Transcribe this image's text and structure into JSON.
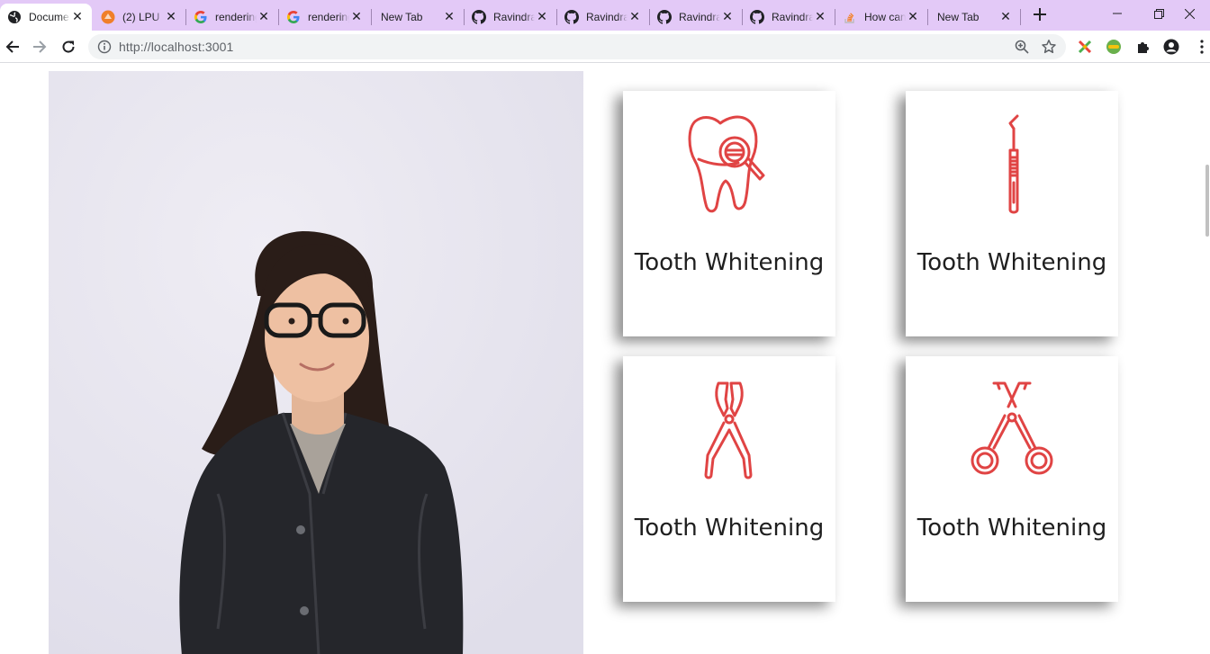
{
  "browser": {
    "tabs": [
      {
        "title": "Document",
        "icon": "globe-icon",
        "active": true
      },
      {
        "title": "(2) LPU",
        "icon": "lpu-icon"
      },
      {
        "title": "rendering",
        "icon": "google-icon"
      },
      {
        "title": "rendering",
        "icon": "google-icon"
      },
      {
        "title": "New Tab",
        "icon": ""
      },
      {
        "title": "Ravindra",
        "icon": "github-icon"
      },
      {
        "title": "Ravindra",
        "icon": "github-icon"
      },
      {
        "title": "Ravindra",
        "icon": "github-icon"
      },
      {
        "title": "Ravindra",
        "icon": "github-icon"
      },
      {
        "title": "How can",
        "icon": "stackoverflow-icon"
      },
      {
        "title": "New Tab",
        "icon": ""
      }
    ],
    "url": "http://localhost:3001"
  },
  "services": [
    {
      "title": "Tooth Whitening",
      "icon": "tooth-magnifier-icon"
    },
    {
      "title": "Tooth Whitening",
      "icon": "dental-probe-icon"
    },
    {
      "title": "Tooth Whitening",
      "icon": "dental-pliers-icon"
    },
    {
      "title": "Tooth Whitening",
      "icon": "dental-forceps-icon"
    }
  ],
  "colors": {
    "accent": "#e04444",
    "tabstrip": "#e3c9f7"
  }
}
